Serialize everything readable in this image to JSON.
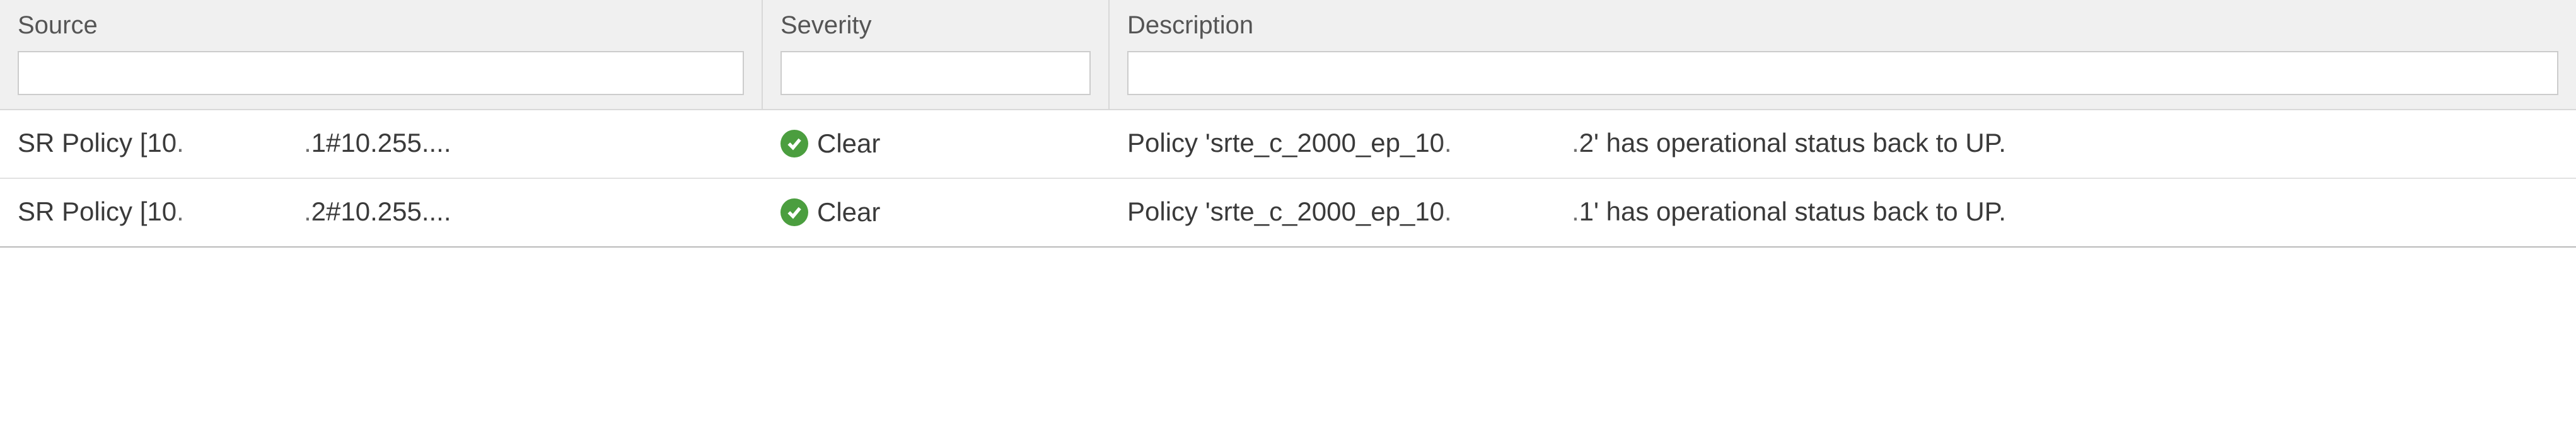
{
  "columns": {
    "source": {
      "label": "Source"
    },
    "severity": {
      "label": "Severity"
    },
    "description": {
      "label": "Description"
    }
  },
  "filters": {
    "source_value": "",
    "severity_value": "",
    "description_value": ""
  },
  "rows": [
    {
      "source_prefix": "SR Policy [10.",
      "source_redacted": "███.███",
      "source_suffix": ".1#10.255....",
      "severity_label": "Clear",
      "severity_color": "#4b9e3f",
      "desc_prefix": "Policy 'srte_c_2000_ep_10.",
      "desc_redacted": "███.███",
      "desc_suffix": ".2' has operational status back to UP."
    },
    {
      "source_prefix": "SR Policy [10.",
      "source_redacted": "███.███",
      "source_suffix": ".2#10.255....",
      "severity_label": "Clear",
      "severity_color": "#4b9e3f",
      "desc_prefix": "Policy 'srte_c_2000_ep_10.",
      "desc_redacted": "███.███",
      "desc_suffix": ".1' has operational status back to UP."
    }
  ]
}
